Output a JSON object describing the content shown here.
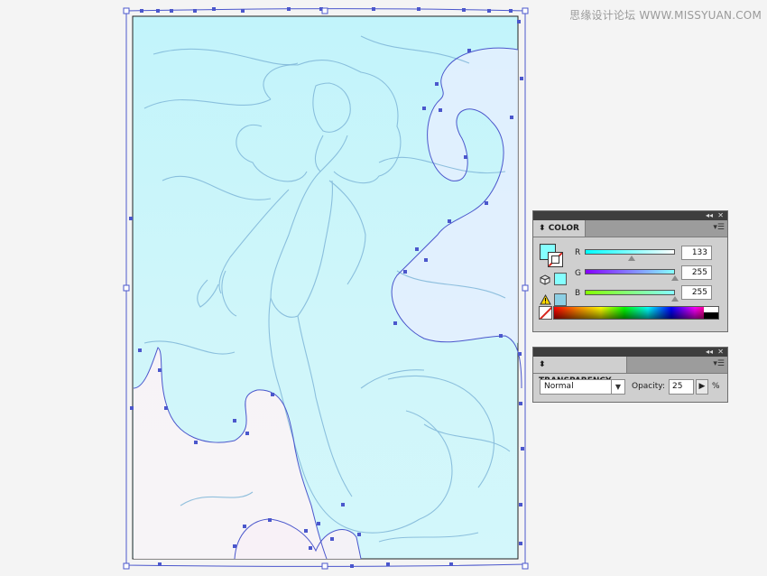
{
  "watermark": "思缘设计论坛  WWW.MISSYUAN.COM",
  "colors": {
    "fill": "#85ffff",
    "artboard_bg_top": "#c5f6fb",
    "selection": "#4b57cc",
    "sketch_line": "#7fb6d8",
    "panel_bg": "#cfcfcf"
  },
  "color_panel": {
    "title": "COLOR",
    "menu_icon": "panel-menu-icon",
    "collapse_icon": "double-chevron-icon",
    "channels": [
      {
        "label": "R",
        "value": "133",
        "fraction": 0.52
      },
      {
        "label": "G",
        "value": "255",
        "fraction": 1.0
      },
      {
        "label": "B",
        "value": "255",
        "fraction": 1.0
      }
    ]
  },
  "transparency_panel": {
    "title": "TRANSPARENCY",
    "blend_mode": "Normal",
    "opacity_label": "Opacity:",
    "opacity_value": "25",
    "opacity_unit": "%"
  }
}
